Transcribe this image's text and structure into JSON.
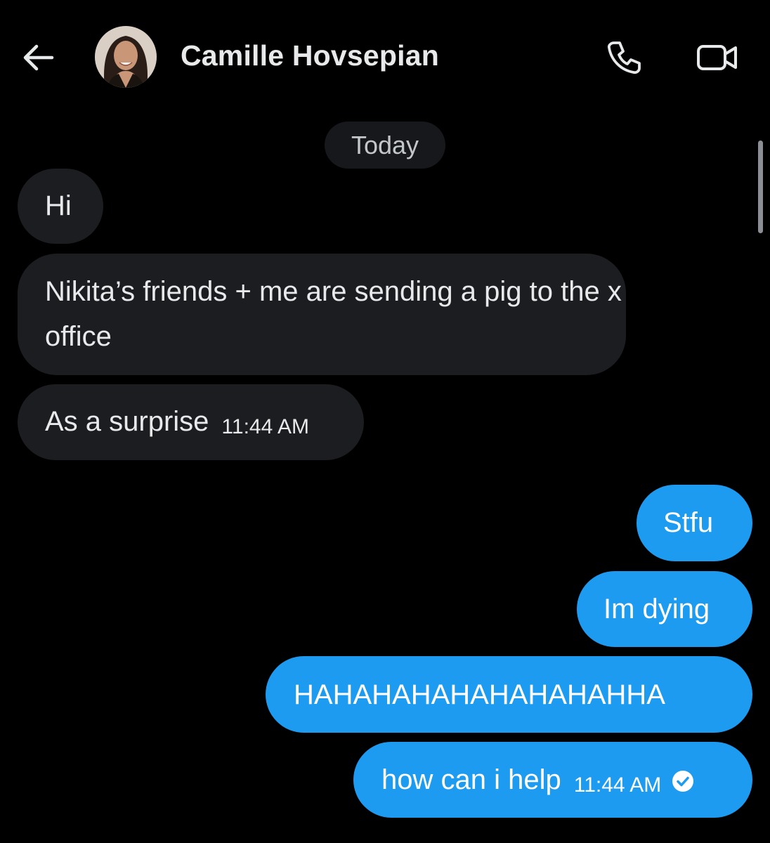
{
  "header": {
    "back_icon": "arrow-left-icon",
    "contact_name": "Camille Hovsepian",
    "call_icon": "phone-icon",
    "video_icon": "video-camera-icon"
  },
  "thread": {
    "date_separator": "Today",
    "messages": [
      {
        "direction": "incoming",
        "text": "Hi"
      },
      {
        "direction": "incoming",
        "text": "Nikita’s friends + me are sending a pig to the x office"
      },
      {
        "direction": "incoming",
        "text": "As a surprise",
        "time": "11:44 AM"
      },
      {
        "direction": "outgoing",
        "text": "Stfu"
      },
      {
        "direction": "outgoing",
        "text": "Im dying"
      },
      {
        "direction": "outgoing",
        "text": "HAHAHAHAHAHAHAHAHHA"
      },
      {
        "direction": "outgoing",
        "text": "how can i help",
        "time": "11:44 AM",
        "status_icon": "read-check-icon"
      }
    ]
  },
  "colors": {
    "background": "#000000",
    "incoming_bubble": "#1c1d20",
    "outgoing_bubble": "#1d9bf0",
    "text": "#e7e9ea"
  }
}
